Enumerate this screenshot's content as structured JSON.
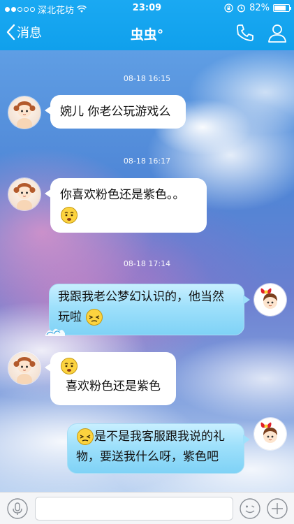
{
  "status_bar": {
    "carrier": "深北花坊",
    "time": "23:09",
    "battery_percent": "82%",
    "battery_level": 0.82
  },
  "nav": {
    "back_label": "消息",
    "title": "虫虫°"
  },
  "messages": [
    {
      "timestamp": "08-18 16:15",
      "side": "left",
      "text": "婉儿 你老公玩游戏么"
    },
    {
      "timestamp": "08-18 16:17",
      "side": "left",
      "text": "你喜欢粉色还是紫色。。",
      "emoji": "pouting-emoji"
    },
    {
      "timestamp": "08-18 17:14",
      "side": "right",
      "line1": "我跟我老公梦幻认识的，他当然",
      "line2": "玩啦",
      "emoji": "squinting-emoji"
    },
    {
      "side": "left",
      "emoji": "pouting-emoji",
      "text": "喜欢粉色还是紫色"
    },
    {
      "side": "right",
      "emoji": "squinting-emoji",
      "line1": "是不是我客服跟我说的礼",
      "line2": "物，要送我什么呀，紫色吧"
    }
  ],
  "input": {
    "placeholder": ""
  },
  "colors": {
    "header": "#12a3ee",
    "incoming_bubble": "#ffffff",
    "outgoing_bubble": "#9ee0fb",
    "timestamp_text": "#ffffff"
  },
  "icons": {
    "signal": "signal-dots-icon",
    "wifi": "wifi-icon",
    "lock": "orientation-lock-icon",
    "alarm": "alarm-icon",
    "battery": "battery-icon",
    "back": "chevron-left-icon",
    "call": "phone-icon",
    "profile": "person-icon",
    "voice": "microphone-icon",
    "emoji": "smiley-icon",
    "more": "plus-icon"
  }
}
